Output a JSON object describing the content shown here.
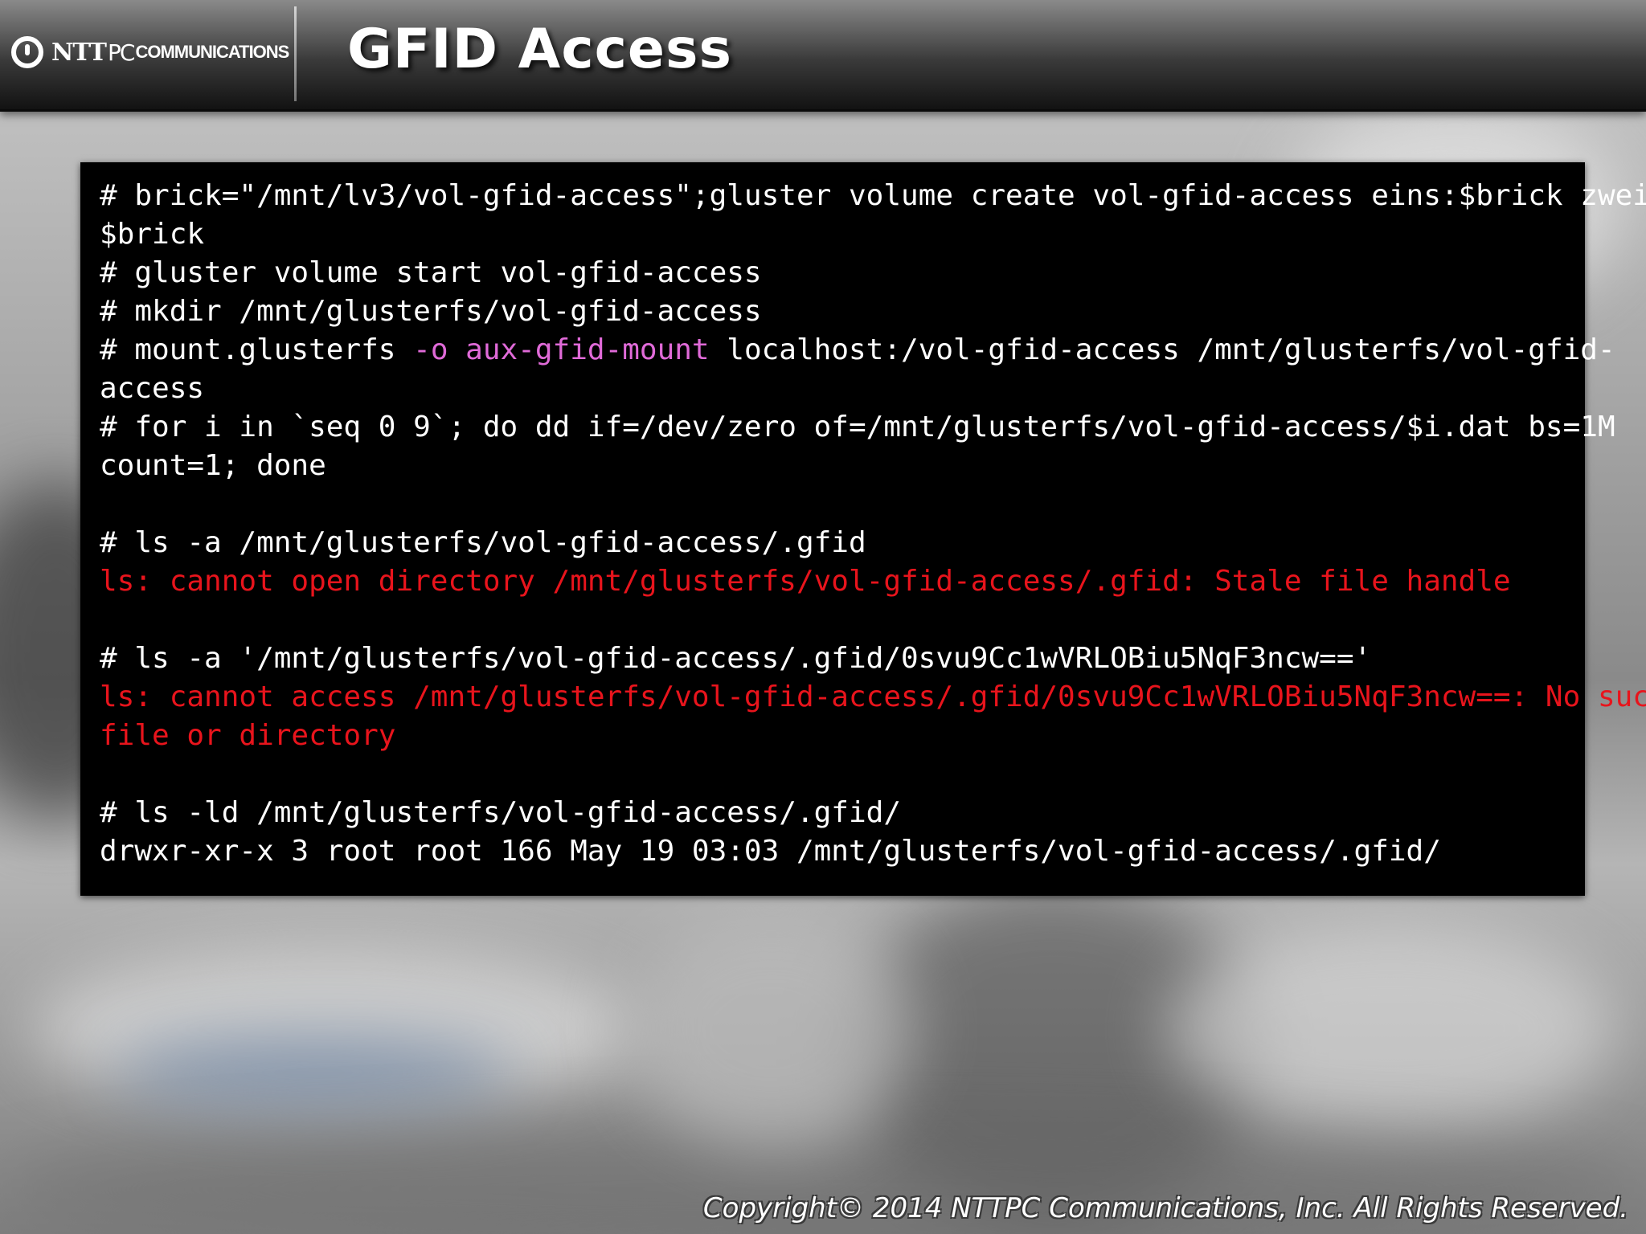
{
  "header": {
    "logo": {
      "ntt": "NTT",
      "pc": "PC",
      "communications": "COMMUNICATIONS"
    },
    "title": "GFID Access"
  },
  "terminal": {
    "lines": [
      {
        "text": "# brick=\"/mnt/lv3/vol-gfid-access\";gluster volume create vol-gfid-access eins:$brick zwei:"
      },
      {
        "text": "$brick"
      },
      {
        "text": "# gluster volume start vol-gfid-access"
      },
      {
        "text": "# mkdir /mnt/glusterfs/vol-gfid-access"
      },
      {
        "pre": "# mount.glusterfs ",
        "highlight": "-o aux-gfid-mount",
        "post": " localhost:/vol-gfid-access /mnt/glusterfs/vol-gfid-"
      },
      {
        "text": "access"
      },
      {
        "text": "# for i in `seq 0 9`; do dd if=/dev/zero of=/mnt/glusterfs/vol-gfid-access/$i.dat bs=1M"
      },
      {
        "text": "count=1; done"
      },
      {
        "text": ""
      },
      {
        "text": "# ls -a /mnt/glusterfs/vol-gfid-access/.gfid"
      },
      {
        "text": "ls: cannot open directory /mnt/glusterfs/vol-gfid-access/.gfid: Stale file handle",
        "error": true
      },
      {
        "text": ""
      },
      {
        "text": "# ls -a '/mnt/glusterfs/vol-gfid-access/.gfid/0svu9Cc1wVRLOBiu5NqF3ncw=='"
      },
      {
        "text": "ls: cannot access /mnt/glusterfs/vol-gfid-access/.gfid/0svu9Cc1wVRLOBiu5NqF3ncw==: No such",
        "error": true
      },
      {
        "text": "file or directory",
        "error": true
      },
      {
        "text": ""
      },
      {
        "text": "# ls -ld /mnt/glusterfs/vol-gfid-access/.gfid/"
      },
      {
        "text": "drwxr-xr-x 3 root root 166 May 19 03:03 /mnt/glusterfs/vol-gfid-access/.gfid/"
      }
    ]
  },
  "footer": {
    "copyright": "Copyright© 2014 NTTPC Communications, Inc. All Rights Reserved."
  },
  "colors": {
    "terminal_bg": "#000000",
    "terminal_text": "#ffffff",
    "error_text": "#e8141c",
    "option_highlight": "#e06ad8"
  }
}
